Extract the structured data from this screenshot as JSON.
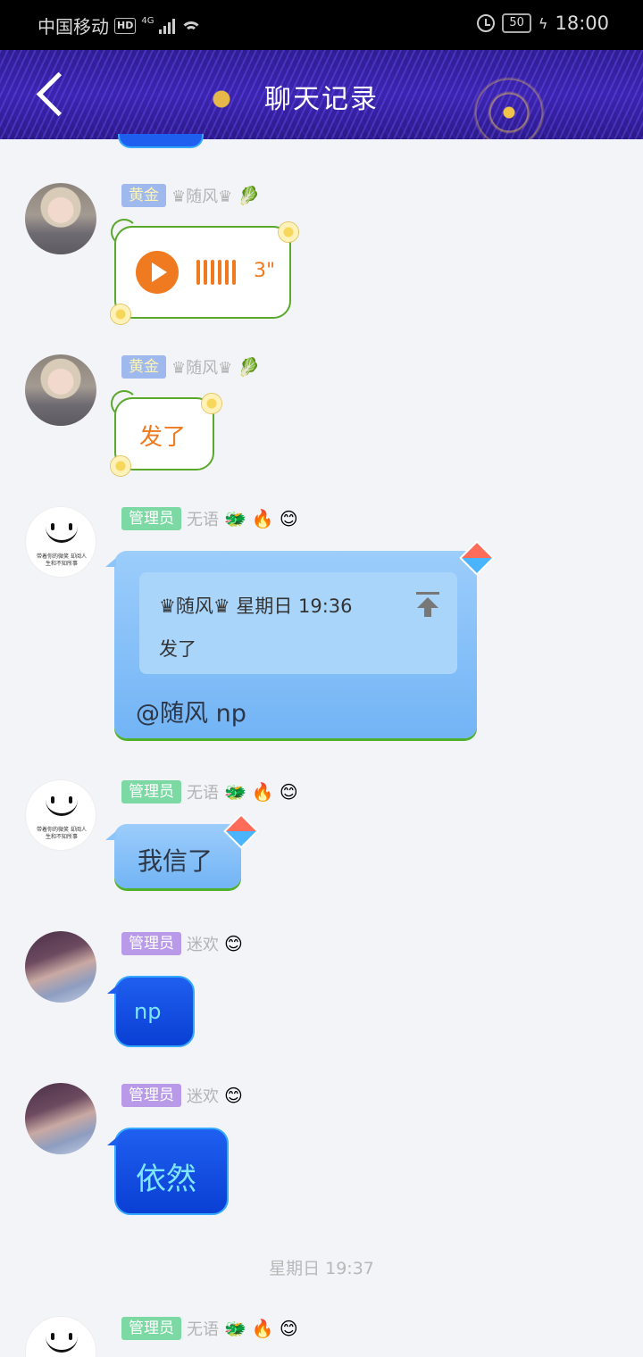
{
  "status_bar": {
    "carrier": "中国移动",
    "hd": "HD",
    "network": "4G",
    "battery": "50",
    "time": "18:00"
  },
  "header": {
    "title": "聊天记录"
  },
  "messages": [
    {
      "badge": "黄金",
      "nickname": "♛随风♛",
      "decor_emoji": "🥬",
      "type": "voice",
      "duration": "3\""
    },
    {
      "badge": "黄金",
      "nickname": "♛随风♛",
      "decor_emoji": "🥬",
      "type": "text",
      "text": "发了"
    },
    {
      "badge": "管理员",
      "nickname": "无语",
      "decor_emojis": [
        "🐲",
        "🔥",
        "😊"
      ],
      "type": "reply",
      "quote_header": "♛随风♛ 星期日 19:36",
      "quote_text": "发了",
      "text": "@随风 np"
    },
    {
      "badge": "管理员",
      "nickname": "无语",
      "decor_emojis": [
        "🐲",
        "🔥",
        "😊"
      ],
      "type": "text",
      "text": "我信了"
    },
    {
      "badge": "管理员",
      "nickname": "迷欢",
      "decor_emojis": [
        "😊"
      ],
      "type": "text",
      "text": "np"
    },
    {
      "badge": "管理员",
      "nickname": "迷欢",
      "decor_emojis": [
        "😊"
      ],
      "type": "text",
      "text": "依然"
    },
    {
      "badge": "管理员",
      "nickname": "无语",
      "decor_emojis": [
        "🐲",
        "🔥",
        "😊"
      ],
      "type": "partial"
    }
  ],
  "timestamp": "星期日 19:37",
  "avatar_caption": "带着你的微笑 却阅人生和不知所事",
  "colors": {
    "header_bg": "#2d1d8f",
    "gold_badge": "#9fb9ee",
    "admin_green": "#7dd9a4",
    "admin_purple": "#b99ae8",
    "voice_orange": "#f07a20",
    "bubble_blue": "#9ccdfb",
    "bubble_deep": "#1f5ff0"
  }
}
